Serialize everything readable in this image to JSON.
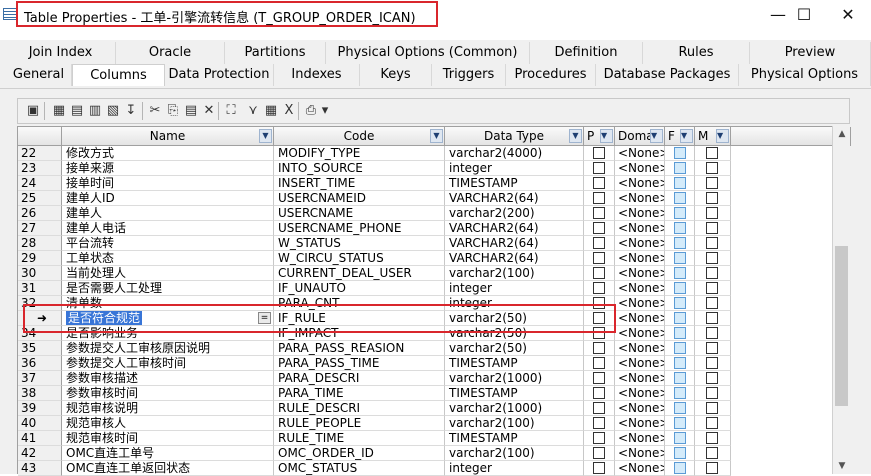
{
  "window": {
    "title": "Table Properties - 工单-引擎流转信息 (T_GROUP_ORDER_ICAN)",
    "minimize_glyph": "—",
    "maximize_glyph": "☐",
    "close_glyph": "✕"
  },
  "tabs_row1": [
    "Join Index",
    "Oracle",
    "Partitions",
    "Physical Options (Common)",
    "Definition",
    "Rules",
    "Preview"
  ],
  "tabs_row2": [
    "General",
    "Columns",
    "Data Protection",
    "Indexes",
    "Keys",
    "Triggers",
    "Procedures",
    "Database Packages",
    "Physical Options"
  ],
  "active_tab": "Columns",
  "toolbar": {
    "icons": [
      "properties-icon",
      "add-row-icon",
      "insert-row-icon",
      "add-columns-icon",
      "reuse-icon",
      "find-icon",
      "cut-icon",
      "copy-icon",
      "paste-icon",
      "delete-icon",
      "find-binoculars-icon",
      "filter-icon",
      "customize-columns-icon",
      "excel-export-icon",
      "print-icon",
      "dropdown-icon"
    ],
    "glyphs": [
      "▣",
      "▦",
      "▤",
      "▥",
      "▧",
      "↧",
      "✂",
      "⎘",
      "▤",
      "✕",
      "⛶",
      "⋎",
      "▦",
      "X",
      "⎙",
      "▾"
    ]
  },
  "grid": {
    "headers": {
      "name": "Name",
      "code": "Code",
      "data_type": "Data Type",
      "p": "P",
      "domain": "Doma",
      "f": "F",
      "m": "M"
    },
    "dropdown_glyph": "▼",
    "selected_row_marker": "➜",
    "ellipsis_glyph": "=",
    "rows": [
      {
        "num": "22",
        "name": "修改方式",
        "code": "MODIFY_TYPE",
        "type": "varchar2(4000)",
        "domain": "<None>"
      },
      {
        "num": "23",
        "name": "接单来源",
        "code": "INTO_SOURCE",
        "type": "integer",
        "domain": "<None>"
      },
      {
        "num": "24",
        "name": "接单时间",
        "code": "INSERT_TIME",
        "type": "TIMESTAMP",
        "domain": "<None>"
      },
      {
        "num": "25",
        "name": "建单人ID",
        "code": "USERCNAMEID",
        "type": "VARCHAR2(64)",
        "domain": "<None>"
      },
      {
        "num": "26",
        "name": "建单人",
        "code": "USERCNAME",
        "type": "varchar2(200)",
        "domain": "<None>"
      },
      {
        "num": "27",
        "name": "建单人电话",
        "code": "USERCNAME_PHONE",
        "type": "VARCHAR2(64)",
        "domain": "<None>"
      },
      {
        "num": "28",
        "name": "平台流转",
        "code": "W_STATUS",
        "type": "VARCHAR2(64)",
        "domain": "<None>"
      },
      {
        "num": "29",
        "name": "工单状态",
        "code": "W_CIRCU_STATUS",
        "type": "VARCHAR2(64)",
        "domain": "<None>"
      },
      {
        "num": "30",
        "name": "当前处理人",
        "code": "CURRENT_DEAL_USER",
        "type": "varchar2(100)",
        "domain": "<None>"
      },
      {
        "num": "31",
        "name": "是否需要人工处理",
        "code": "IF_UNAUTO",
        "type": "integer",
        "domain": "<None>"
      },
      {
        "num": "32",
        "name": "清单数",
        "code": "PARA_CNT",
        "type": "integer",
        "domain": "<None>"
      },
      {
        "num": "",
        "name": "是否符合规范",
        "code": "IF_RULE",
        "type": "varchar2(50)",
        "domain": "<None>"
      },
      {
        "num": "34",
        "name": "是否影响业务",
        "code": "IF_IMPACT",
        "type": "varchar2(50)",
        "domain": "<None>"
      },
      {
        "num": "35",
        "name": "参数提交人工审核原因说明",
        "code": "PARA_PASS_REASION",
        "type": "varchar2(50)",
        "domain": "<None>"
      },
      {
        "num": "36",
        "name": "参数提交人工审核时间",
        "code": "PARA_PASS_TIME",
        "type": "TIMESTAMP",
        "domain": "<None>"
      },
      {
        "num": "37",
        "name": "参数审核描述",
        "code": "PARA_DESCRI",
        "type": "varchar2(1000)",
        "domain": "<None>"
      },
      {
        "num": "38",
        "name": "参数审核时间",
        "code": "PARA_TIME",
        "type": "TIMESTAMP",
        "domain": "<None>"
      },
      {
        "num": "39",
        "name": "规范审核说明",
        "code": "RULE_DESCRI",
        "type": "varchar2(1000)",
        "domain": "<None>"
      },
      {
        "num": "40",
        "name": "规范审核人",
        "code": "RULE_PEOPLE",
        "type": "varchar2(100)",
        "domain": "<None>"
      },
      {
        "num": "41",
        "name": "规范审核时间",
        "code": "RULE_TIME",
        "type": "TIMESTAMP",
        "domain": "<None>"
      },
      {
        "num": "42",
        "name": "OMC直连工单号",
        "code": "OMC_ORDER_ID",
        "type": "varchar2(100)",
        "domain": "<None>"
      },
      {
        "num": "43",
        "name": "OMC直连工单返回状态",
        "code": "OMC_STATUS",
        "type": "integer",
        "domain": "<None>"
      }
    ]
  },
  "scrollbar": {
    "up_glyph": "▲",
    "down_glyph": "▼"
  },
  "colors": {
    "highlight_box": "#d9262c",
    "selection": "#3875d7"
  }
}
